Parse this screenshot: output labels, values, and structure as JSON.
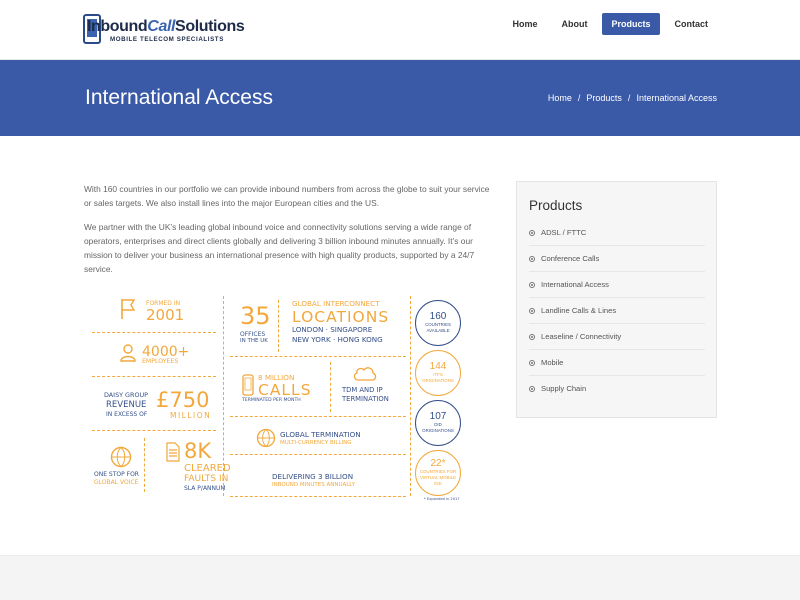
{
  "logo": {
    "brand_a": "Inbound",
    "brand_b": "Call",
    "brand_c": "Solutions",
    "tagline": "MOBILE TELECOM SPECIALISTS"
  },
  "nav": {
    "home": "Home",
    "about": "About",
    "products": "Products",
    "contact": "Contact"
  },
  "banner": {
    "title": "International Access",
    "breadcrumb": {
      "home": "Home",
      "sep1": "/",
      "products": "Products",
      "sep2": "/",
      "current": "International Access"
    }
  },
  "content": {
    "p1": "With 160 countries in our portfolio we can provide inbound numbers from across the globe to suit your service or sales targets. We also install lines into the major European cities and the US.",
    "p2": "We partner with the UK’s leading global inbound voice and connectivity solutions serving a wide range of operators, enterprises and direct clients globally and delivering 3 billion inbound minutes annually. It’s our mission to deliver your business an international presence with high quality products, supported by a 24/7 service."
  },
  "infographic": {
    "formed_label": "FORMED IN",
    "formed_year": "2001",
    "offices_num": "35",
    "offices_label1": "OFFICES",
    "offices_label2": "IN THE UK",
    "interconnect_label": "GLOBAL INTERCONNECT",
    "locations": "LOCATIONS",
    "cities1": "LONDON · SINGAPORE",
    "cities2": "NEW YORK · HONG KONG",
    "employees_num": "4000+",
    "employees_label": "EMPLOYEES",
    "calls_top": "8 MILLION",
    "calls_word": "CALLS",
    "calls_sub": "TERMINATED PER MONTH",
    "tdm1": "TDM AND IP",
    "tdm2": "TERMINATION",
    "revenue1": "DAISY GROUP",
    "revenue2": "REVENUE",
    "revenue3": "IN EXCESS OF",
    "revenue_num": "£750",
    "revenue_unit": "MILLION",
    "global_term": "GLOBAL TERMINATION",
    "multi_currency": "MULTI-CURRENCY BILLING",
    "onestop1": "ONE STOP FOR",
    "onestop2": "GLOBAL VOICE",
    "faults_num": "8K",
    "faults1": "CLEARED",
    "faults2": "FAULTS IN",
    "faults3": "SLA P/ANNUM",
    "delivering1": "DELIVERING 3 BILLION",
    "delivering2": "INBOUND MINUTES ANNUALLY",
    "c1_num": "160",
    "c1_lab1": "COUNTRIES",
    "c1_lab2": "AVAILABLE",
    "c2_num": "144",
    "c2_lab1": "ITFS",
    "c2_lab2": "ORIGINATIONS",
    "c3_num": "107",
    "c3_lab1": "DID",
    "c3_lab2": "ORIGINATIONS",
    "c4_num": "22*",
    "c4_lab1": "COUNTRIES FOR",
    "c4_lab2": "VIRTUAL MOBILE",
    "c4_lab3": "DID",
    "footnote": "* Expanded in 2017"
  },
  "sidebar": {
    "title": "Products",
    "items": [
      "ADSL / FTTC",
      "Conference Calls",
      "International Access",
      "Landline Calls & Lines",
      "Leaseline / Connectivity",
      "Mobile",
      "Supply Chain"
    ]
  }
}
